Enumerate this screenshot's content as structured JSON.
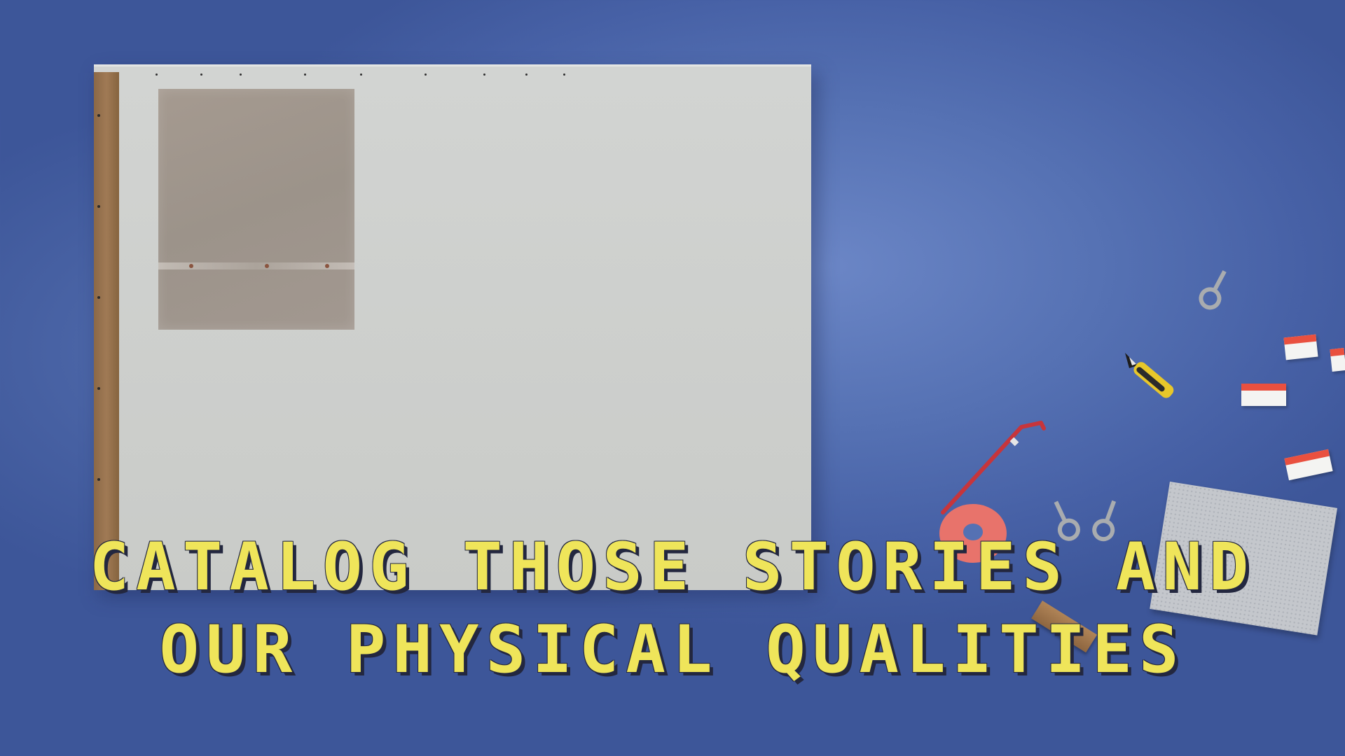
{
  "scene": {
    "background_color": "#5571b3",
    "board_color": "#cdcfcc",
    "patch_color": "#a0968d",
    "stud_color": "#99734f"
  },
  "caption": {
    "line1": "CATALOG THOSE STORIES AND",
    "line2": "OUR PHYSICAL QUALITIES",
    "color": "#efe55a",
    "outline_color": "#23273f"
  },
  "props": {
    "eye_bolts": [
      "eye-bolt-icon",
      "eye-bolt-icon",
      "eye-bolt-icon"
    ],
    "utility_knife": "utility-knife-icon",
    "pry_bar": "pry-bar-icon",
    "tape_roll": "tape-roll-icon",
    "label_cards": 4,
    "label_card_stripe_color": "#e9503f",
    "knife_color": "#e8c72a",
    "tape_color": "#e8736b"
  }
}
